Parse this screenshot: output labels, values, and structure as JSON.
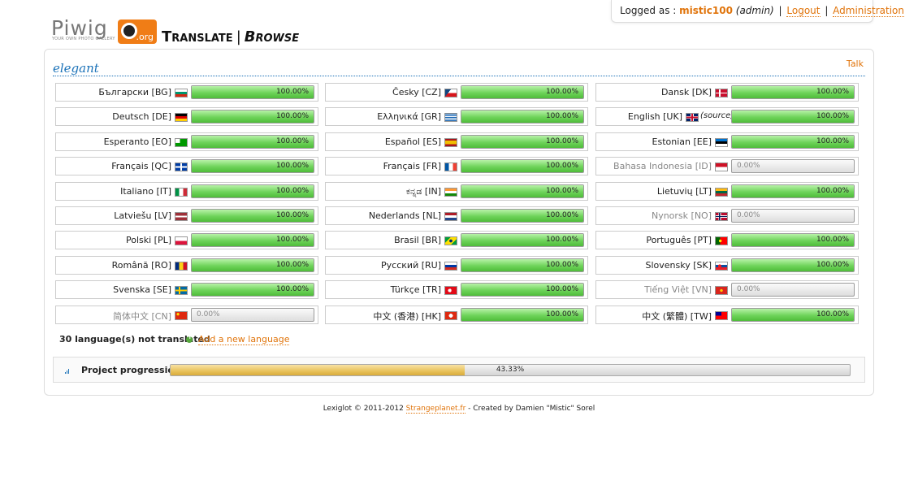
{
  "header": {
    "logo_text": "Piwig",
    "logo_org": ".org",
    "logo_tagline": "YOUR OWN PHOTO GALLERY",
    "title_translate": "Translate",
    "title_separator": "|",
    "title_browse": "Browse"
  },
  "user": {
    "logged_as_label": "Logged as : ",
    "username": "mistic100",
    "role": "(admin)",
    "separator": " | ",
    "logout": "Logout",
    "administration": "Administration"
  },
  "section": {
    "title": "elegant",
    "talk": "Talk"
  },
  "languages": [
    {
      "label": "Български [BG]",
      "flag": "bg",
      "progress": "100.00%",
      "fraction": 1.0,
      "translated": true
    },
    {
      "label": "Česky [CZ]",
      "flag": "cz",
      "progress": "100.00%",
      "fraction": 1.0,
      "translated": true
    },
    {
      "label": "Dansk [DK]",
      "flag": "dk",
      "progress": "100.00%",
      "fraction": 1.0,
      "translated": true
    },
    {
      "label": "Deutsch [DE]",
      "flag": "de",
      "progress": "100.00%",
      "fraction": 1.0,
      "translated": true
    },
    {
      "label": "Ελληνικά [GR]",
      "flag": "gr",
      "progress": "100.00%",
      "fraction": 1.0,
      "translated": true
    },
    {
      "label": "English [UK]",
      "suffix": "(source)",
      "flag": "uk",
      "progress": "100.00%",
      "fraction": 1.0,
      "translated": true
    },
    {
      "label": "Esperanto [EO]",
      "flag": "eo",
      "progress": "100.00%",
      "fraction": 1.0,
      "translated": true
    },
    {
      "label": "Español [ES]",
      "flag": "es",
      "progress": "100.00%",
      "fraction": 1.0,
      "translated": true
    },
    {
      "label": "Estonian [EE]",
      "flag": "ee",
      "progress": "100.00%",
      "fraction": 1.0,
      "translated": true
    },
    {
      "label": "Français [QC]",
      "flag": "qc",
      "progress": "100.00%",
      "fraction": 1.0,
      "translated": true
    },
    {
      "label": "Français [FR]",
      "flag": "fr",
      "progress": "100.00%",
      "fraction": 1.0,
      "translated": true
    },
    {
      "label": "Bahasa Indonesia [ID]",
      "flag": "id",
      "progress": "0.00%",
      "fraction": 0.0,
      "translated": false
    },
    {
      "label": "Italiano [IT]",
      "flag": "it",
      "progress": "100.00%",
      "fraction": 1.0,
      "translated": true
    },
    {
      "label": "ಕನ್ನಡ [IN]",
      "flag": "in",
      "progress": "100.00%",
      "fraction": 1.0,
      "translated": true
    },
    {
      "label": "Lietuvių [LT]",
      "flag": "lt",
      "progress": "100.00%",
      "fraction": 1.0,
      "translated": true
    },
    {
      "label": "Latviešu [LV]",
      "flag": "lv",
      "progress": "100.00%",
      "fraction": 1.0,
      "translated": true
    },
    {
      "label": "Nederlands [NL]",
      "flag": "nl",
      "progress": "100.00%",
      "fraction": 1.0,
      "translated": true
    },
    {
      "label": "Nynorsk [NO]",
      "flag": "no",
      "progress": "0.00%",
      "fraction": 0.0,
      "translated": false
    },
    {
      "label": "Polski [PL]",
      "flag": "pl",
      "progress": "100.00%",
      "fraction": 1.0,
      "translated": true
    },
    {
      "label": "Brasil [BR]",
      "flag": "br",
      "progress": "100.00%",
      "fraction": 1.0,
      "translated": true
    },
    {
      "label": "Português [PT]",
      "flag": "pt",
      "progress": "100.00%",
      "fraction": 1.0,
      "translated": true
    },
    {
      "label": "Română [RO]",
      "flag": "ro",
      "progress": "100.00%",
      "fraction": 1.0,
      "translated": true
    },
    {
      "label": "Русский [RU]",
      "flag": "ru",
      "progress": "100.00%",
      "fraction": 1.0,
      "translated": true
    },
    {
      "label": "Slovensky [SK]",
      "flag": "sk",
      "progress": "100.00%",
      "fraction": 1.0,
      "translated": true
    },
    {
      "label": "Svenska [SE]",
      "flag": "se",
      "progress": "100.00%",
      "fraction": 1.0,
      "translated": true
    },
    {
      "label": "Türkçe [TR]",
      "flag": "tr",
      "progress": "100.00%",
      "fraction": 1.0,
      "translated": true
    },
    {
      "label": "Tiếng Việt [VN]",
      "flag": "vn",
      "progress": "0.00%",
      "fraction": 0.0,
      "translated": false
    },
    {
      "label": "简体中文 [CN]",
      "flag": "cn",
      "progress": "0.00%",
      "fraction": 0.0,
      "translated": false
    },
    {
      "label": "中文 (香港) [HK]",
      "flag": "hk",
      "progress": "100.00%",
      "fraction": 1.0,
      "translated": true
    },
    {
      "label": "中文 (繁體) [TW]",
      "flag": "tw",
      "progress": "100.00%",
      "fraction": 1.0,
      "translated": true
    }
  ],
  "summary": {
    "not_translated": "30 language(s) not translated",
    "add_language": "Add a new language",
    "add_icon": "add-icon"
  },
  "project": {
    "label": "Project progression :",
    "progress": "43.33%",
    "fraction": 0.4333,
    "icon": "stats-icon"
  },
  "footer": {
    "prefix": "Lexiglot © 2011-2012 ",
    "link": "Strangeplanet.fr",
    "suffix": " - Created by Damien \"Mistic\" Sorel"
  }
}
